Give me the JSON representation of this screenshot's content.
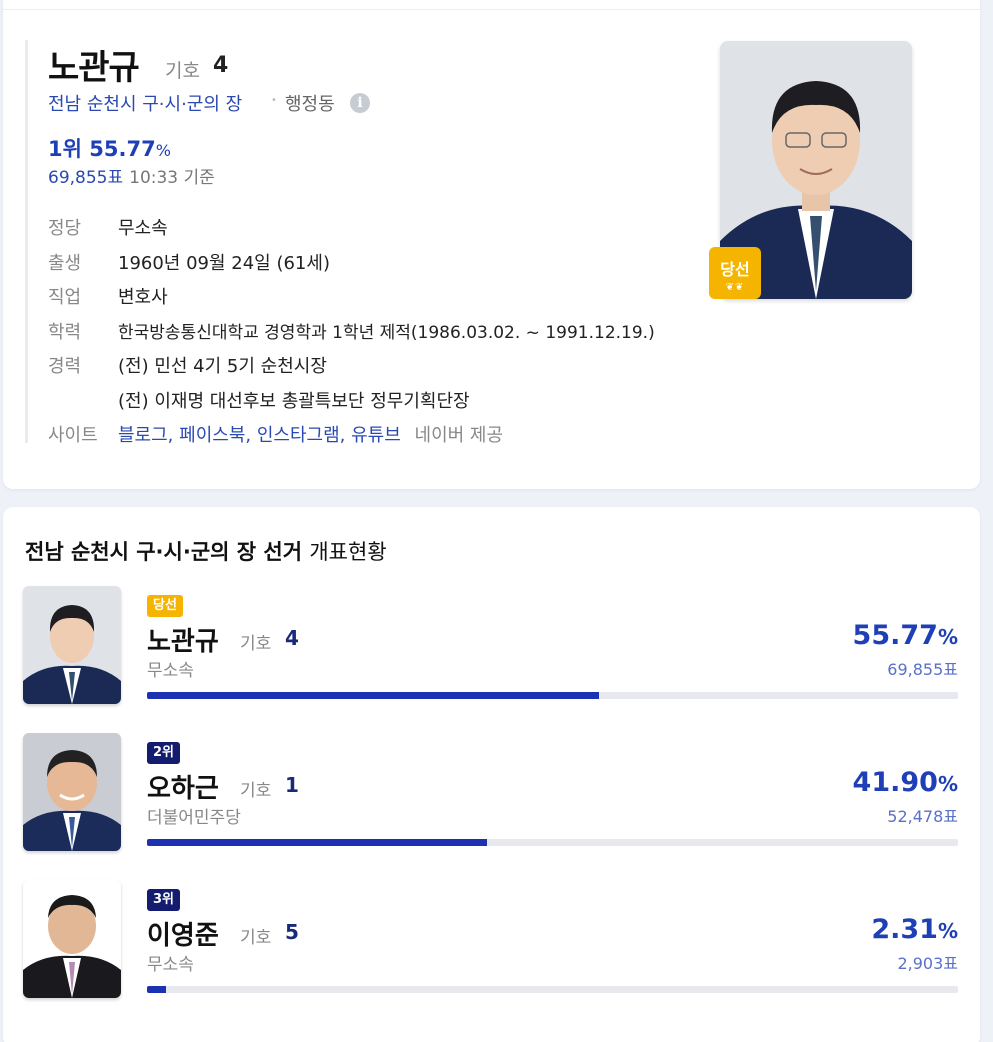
{
  "profile": {
    "name": "노관규",
    "kiho_label": "기호",
    "kiho_number": "4",
    "region": "전남 순천시 구·시·군의 장",
    "region_type": "행정동",
    "rank": "1위",
    "percent": "55.77",
    "percent_unit": "%",
    "votes": "69,855표",
    "time": "10:33 기준",
    "win_badge": "당선",
    "info_icon": "info-icon",
    "rows": [
      {
        "label": "정당",
        "value": "무소속"
      },
      {
        "label": "출생",
        "value": "1960년 09월 24일 (61세)"
      },
      {
        "label": "직업",
        "value": "변호사"
      },
      {
        "label": "학력",
        "value": "한국방송통신대학교 경영학과 1학년 제적(1986.03.02. ~ 1991.12.19.)"
      },
      {
        "label": "경력",
        "value": "(전) 민선 4기 5기 순천시장"
      },
      {
        "label": "",
        "value": "(전) 이재명 대선후보 총괄특보단 정무기획단장"
      }
    ],
    "site_label": "사이트",
    "sites": [
      "블로그,",
      "페이스북,",
      "인스타그램,",
      "유튜브"
    ],
    "site_provider": "네이버 제공"
  },
  "results": {
    "title": "전남 순천시 구·시·군의 장 선거",
    "title_sub": "개표현황",
    "kiho_label": "기호",
    "candidates": [
      {
        "tag": "당선",
        "tag_style": "gold",
        "name": "노관규",
        "number": "4",
        "party": "무소속",
        "percent": "55.77",
        "unit": "%",
        "votes": "69,855표",
        "share": 0.5577
      },
      {
        "tag": "2위",
        "tag_style": "navy",
        "name": "오하근",
        "number": "1",
        "party": "더불어민주당",
        "percent": "41.90",
        "unit": "%",
        "votes": "52,478표",
        "share": 0.419
      },
      {
        "tag": "3위",
        "tag_style": "navy",
        "name": "이영준",
        "number": "5",
        "party": "무소속",
        "percent": "2.31",
        "unit": "%",
        "votes": "2,903표",
        "share": 0.0231
      }
    ]
  },
  "colors": {
    "accent": "#1f3fb6",
    "bar": "#1d31b3",
    "win": "#f5b400",
    "rank": "#131c6e"
  }
}
